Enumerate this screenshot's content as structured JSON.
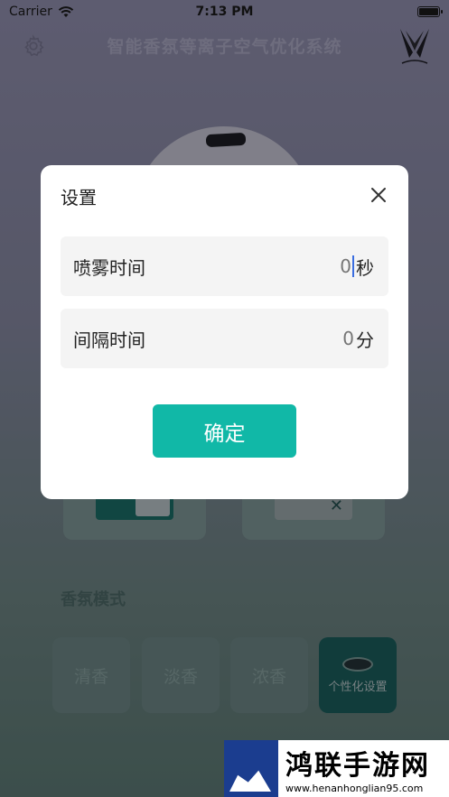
{
  "status_bar": {
    "carrier": "Carrier",
    "time": "7:13 PM"
  },
  "header": {
    "title": "智能香氛等离子空气优化系统",
    "settings_icon": "gear-icon",
    "logo_icon": "wings-logo-icon"
  },
  "background": {
    "section_title": "香氛模式",
    "modes": [
      {
        "label": "清香"
      },
      {
        "label": "淡香"
      },
      {
        "label": "浓香"
      },
      {
        "label": "个性化设置"
      }
    ]
  },
  "dialog": {
    "title": "设置",
    "close_icon": "close-icon",
    "fields": [
      {
        "label": "喷雾时间",
        "placeholder": "0",
        "value": "",
        "unit": "秒"
      },
      {
        "label": "间隔时间",
        "placeholder": "0",
        "value": "",
        "unit": "分"
      }
    ],
    "confirm_label": "确定"
  },
  "watermark": {
    "title": "鸿联手游网",
    "url": "www.henanhonglian95.com"
  },
  "colors": {
    "accent": "#11b8a7",
    "active_mode": "#0f5e52"
  }
}
